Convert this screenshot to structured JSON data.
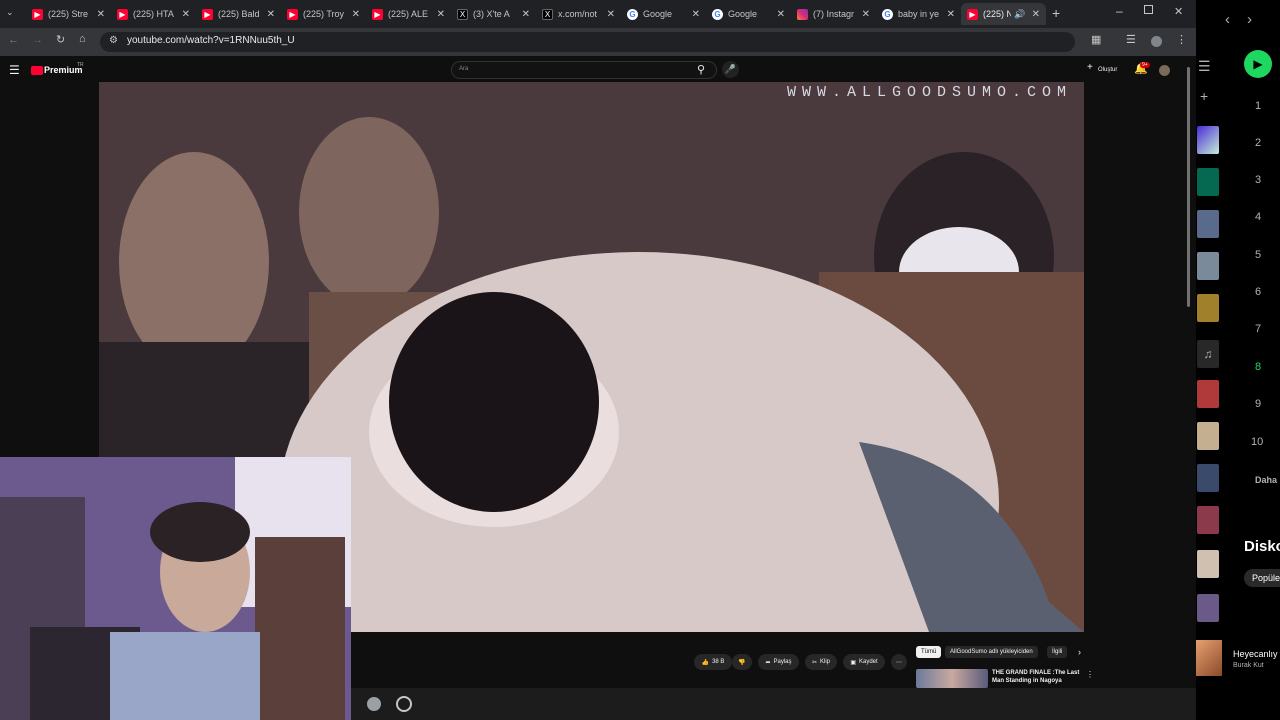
{
  "browser": {
    "tabs": [
      {
        "title": "(225) Stre",
        "icon": "youtube-icon"
      },
      {
        "title": "(225) HTA",
        "icon": "youtube-icon"
      },
      {
        "title": "(225) Bald",
        "icon": "youtube-icon"
      },
      {
        "title": "(225) Troy",
        "icon": "youtube-icon"
      },
      {
        "title": "(225) ALE",
        "icon": "youtube-icon"
      },
      {
        "title": "(3) X'te A",
        "icon": "x-icon"
      },
      {
        "title": "x.com/not",
        "icon": "x-icon"
      },
      {
        "title": "Google",
        "icon": "google-icon"
      },
      {
        "title": "Google",
        "icon": "google-icon"
      },
      {
        "title": "(7) Instagr",
        "icon": "instagram-icon"
      },
      {
        "title": "baby in ye",
        "icon": "google-icon"
      },
      {
        "title": "(225) N",
        "icon": "youtube-icon"
      }
    ],
    "url": "youtube.com/watch?v=1RNNuu5th_U"
  },
  "youtube": {
    "logo_text": "Premium",
    "logo_badge": "TR",
    "search_placeholder": "Ara",
    "create_label": "Oluştur",
    "notif_count": "9+",
    "watermark": "WWW.ALLGOODSUMO.COM",
    "like_count": "38 B",
    "share_label": "Paylaş",
    "clip_label": "Klip",
    "save_label": "Kaydet",
    "chips": [
      "Tümü",
      "AllGoodSumo adlı yükleyiciden",
      "İlgili"
    ],
    "rec_title_1": "THE GRAND FINALE :The Last",
    "rec_title_2": "Man Standing in Nagoya"
  },
  "spotify": {
    "numbers": [
      "1",
      "2",
      "3",
      "4",
      "5",
      "6",
      "7",
      "8",
      "9",
      "10"
    ],
    "more_label": "Daha",
    "disk_label": "Disko",
    "popular_label": "Popüle",
    "now_playing_title": "Heyecanlıy",
    "now_playing_artist": "Burak Kut"
  },
  "colors": {
    "accent": "#ff0033",
    "spotify_green": "#1ed760"
  }
}
